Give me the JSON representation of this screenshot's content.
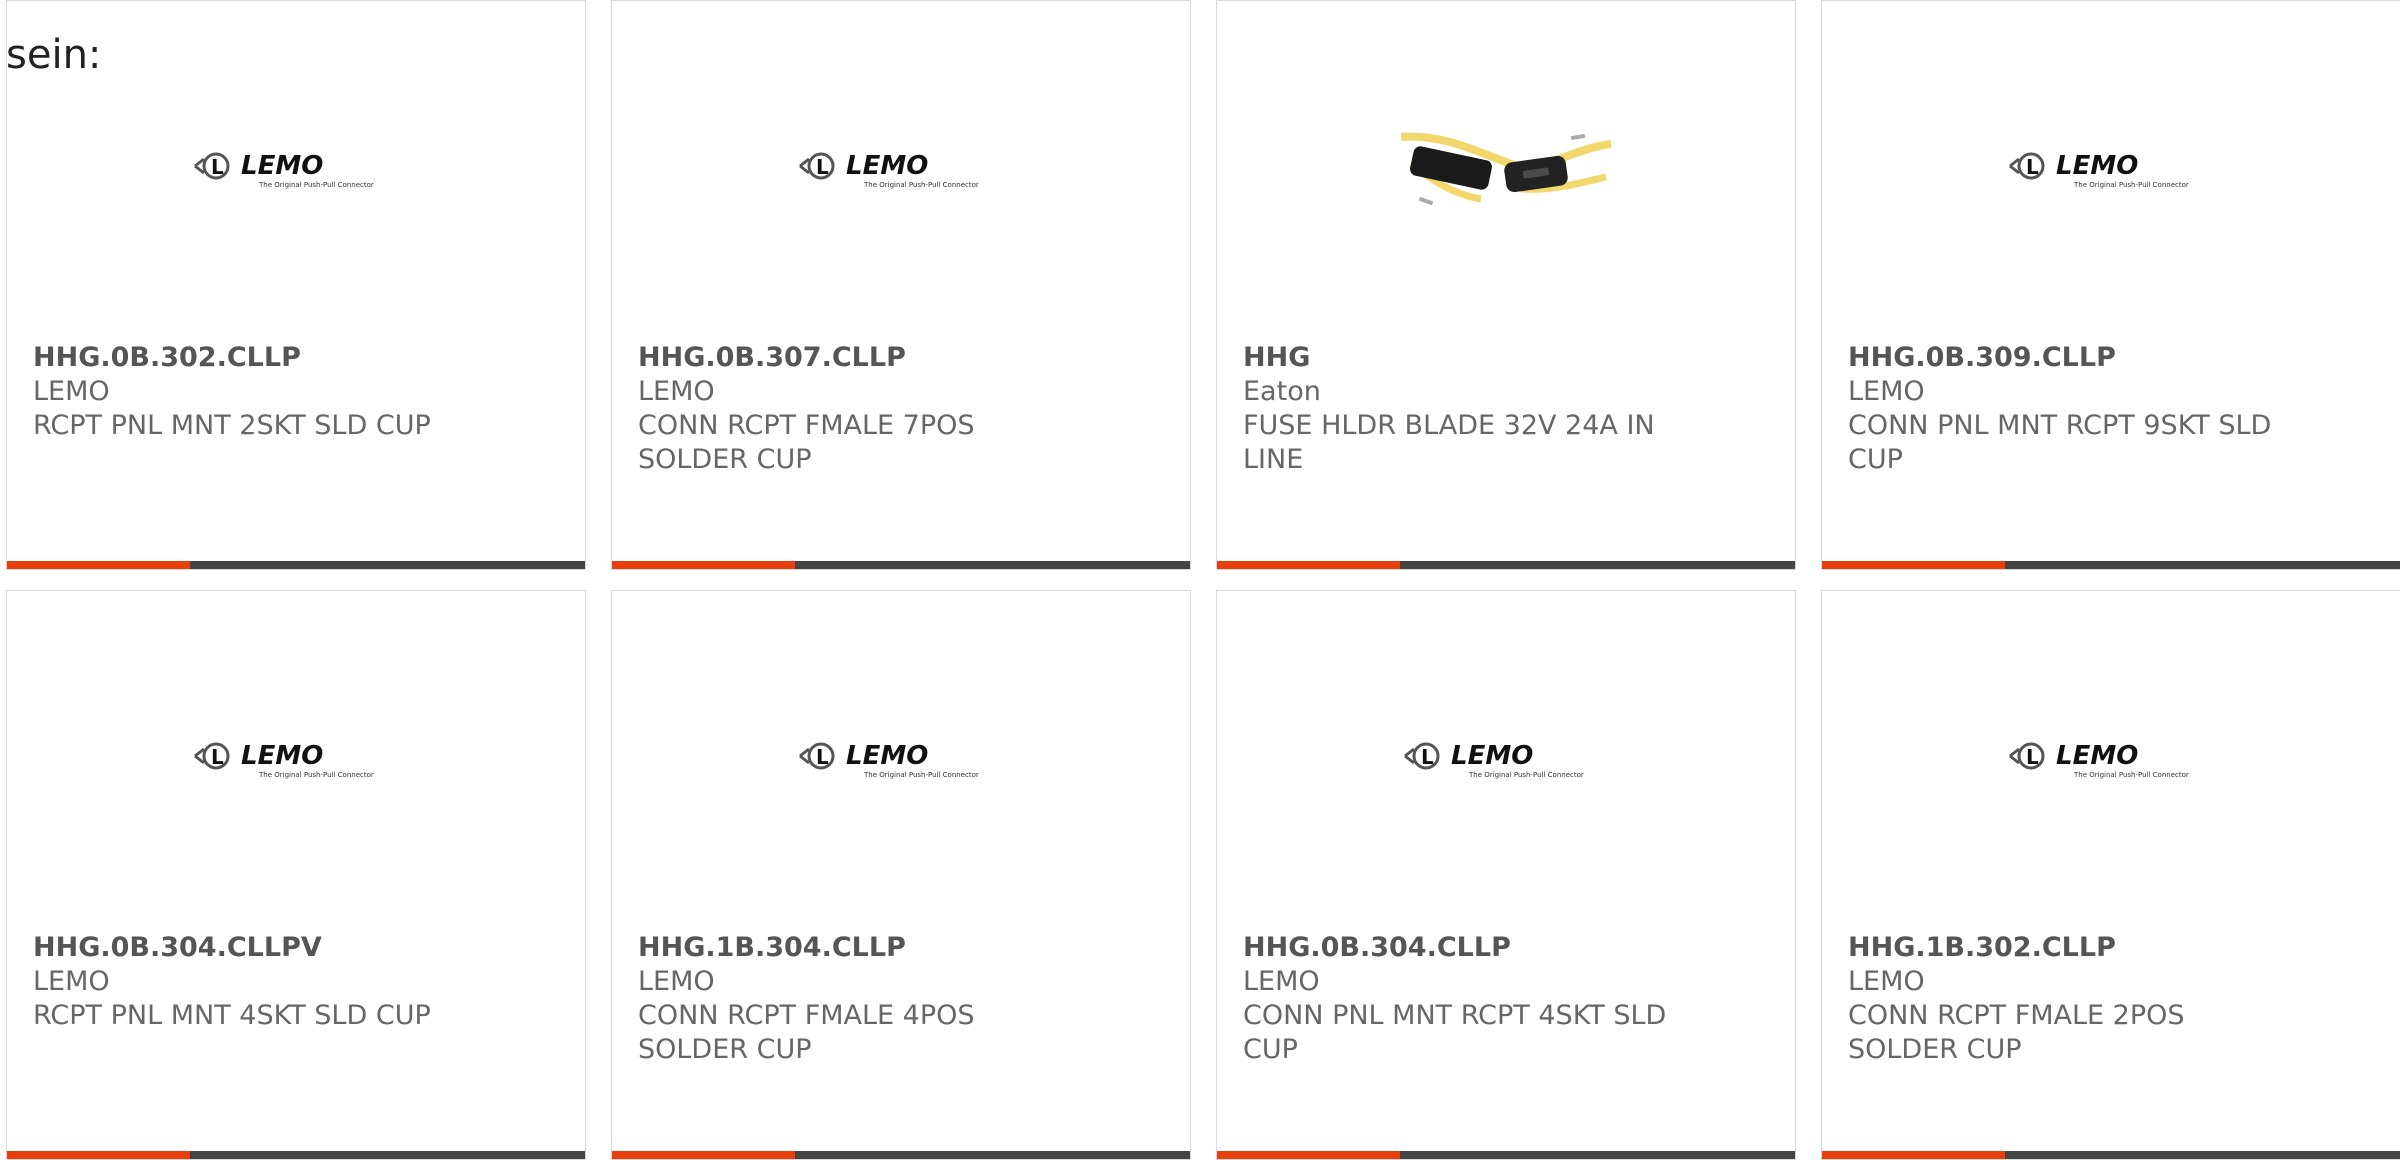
{
  "intro_text": "sein:",
  "colors": {
    "accent": "#e8400c",
    "bar": "#444444"
  },
  "products": [
    {
      "part": "HHG.0B.302.CLLP",
      "mfr": "LEMO",
      "desc": "RCPT PNL MNT 2SKT SLD CUP",
      "image": "lemo-logo"
    },
    {
      "part": "HHG.0B.307.CLLP",
      "mfr": "LEMO",
      "desc": "CONN RCPT FMALE 7POS SOLDER CUP",
      "image": "lemo-logo"
    },
    {
      "part": "HHG",
      "mfr": "Eaton",
      "desc": "FUSE HLDR BLADE 32V 24A IN LINE",
      "image": "fuse-holder-photo"
    },
    {
      "part": "HHG.0B.309.CLLP",
      "mfr": "LEMO",
      "desc": "CONN PNL MNT RCPT 9SKT SLD CUP",
      "image": "lemo-logo"
    },
    {
      "part": "HHG.0B.304.CLLPV",
      "mfr": "LEMO",
      "desc": "RCPT PNL MNT 4SKT SLD CUP",
      "image": "lemo-logo"
    },
    {
      "part": "HHG.1B.304.CLLP",
      "mfr": "LEMO",
      "desc": "CONN RCPT FMALE 4POS SOLDER CUP",
      "image": "lemo-logo"
    },
    {
      "part": "HHG.0B.304.CLLP",
      "mfr": "LEMO",
      "desc": "CONN PNL MNT RCPT 4SKT SLD CUP",
      "image": "lemo-logo"
    },
    {
      "part": "HHG.1B.302.CLLP",
      "mfr": "LEMO",
      "desc": "CONN RCPT FMALE 2POS SOLDER CUP",
      "image": "lemo-logo"
    }
  ],
  "lemo_logo": {
    "wordmark": "LEMO",
    "tagline": "The Original Push-Pull Connector"
  }
}
